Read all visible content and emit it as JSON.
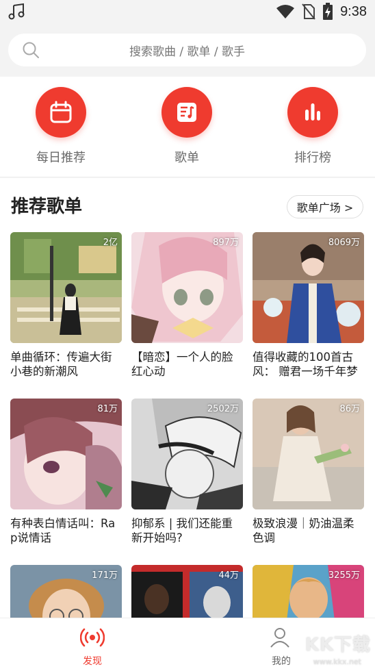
{
  "status_bar": {
    "time": "9:38"
  },
  "search": {
    "placeholder": "搜索歌曲 / 歌单 / 歌手"
  },
  "quick_entries": [
    {
      "label": "每日推荐",
      "icon": "calendar-icon"
    },
    {
      "label": "歌单",
      "icon": "playlist-icon"
    },
    {
      "label": "排行榜",
      "icon": "chart-bars-icon"
    }
  ],
  "recommend": {
    "title": "推荐歌单",
    "plaza_label": "歌单广场 >",
    "playlists": [
      {
        "count": "2亿",
        "title": "单曲循环：传遍大街小巷的新潮风"
      },
      {
        "count": "897万",
        "title": "【暗恋】一个人的脸红心动"
      },
      {
        "count": "8069万",
        "title": "值得收藏的100首古风： 赠君一场千年梦"
      },
      {
        "count": "81万",
        "title": "有种表白情话叫：Rap说情话"
      },
      {
        "count": "2502万",
        "title": "抑郁系 | 我们还能重新开始吗?"
      },
      {
        "count": "86万",
        "title": "极致浪漫｜奶油温柔色调"
      },
      {
        "count": "171万",
        "title": ""
      },
      {
        "count": "44万",
        "title": ""
      },
      {
        "count": "3255万",
        "title": ""
      }
    ]
  },
  "bottom_nav": {
    "discover_label": "发现",
    "mine_label": "我的"
  },
  "watermark": {
    "text": "KK下载",
    "url": "www.kkx.net"
  },
  "colors": {
    "accent": "#ef3b2f",
    "text": "#222222",
    "muted": "#6a6a6a"
  }
}
